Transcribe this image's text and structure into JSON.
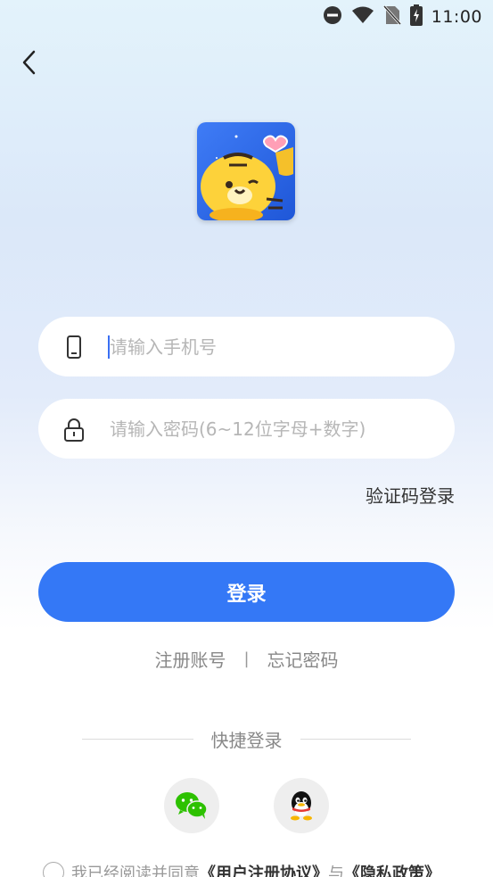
{
  "status_bar": {
    "time": "11:00"
  },
  "form": {
    "phone_placeholder": "请输入手机号",
    "password_placeholder": "请输入密码(6~12位字母+数字)",
    "code_login_label": "验证码登录",
    "login_button_label": "登录"
  },
  "links": {
    "register_label": "注册账号",
    "separator": "|",
    "forgot_label": "忘记密码"
  },
  "quick_login": {
    "label": "快捷登录",
    "providers": [
      "wechat-icon",
      "qq-icon"
    ]
  },
  "agreement": {
    "prefix": "我已经阅读并同意",
    "user_agreement": "《用户注册协议》",
    "conjunction": "与",
    "privacy_policy": "《隐私政策》"
  },
  "colors": {
    "accent": "#3478f6",
    "caret": "#3a6ff3"
  }
}
